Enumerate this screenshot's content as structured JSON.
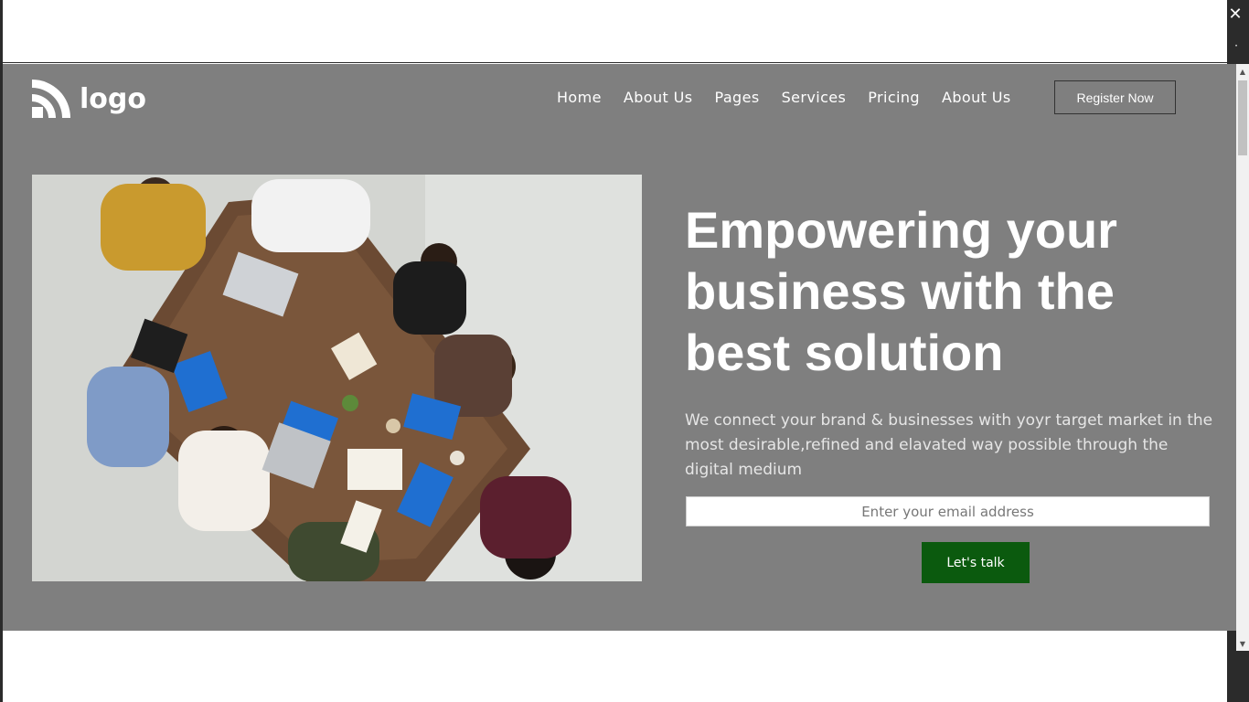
{
  "window": {
    "close_symbol": "✕",
    "menu_symbol": "·"
  },
  "header": {
    "logo_text": "logo",
    "nav": [
      "Home",
      "About Us",
      "Pages",
      "Services",
      "Pricing",
      "About Us"
    ],
    "register_label": "Register Now"
  },
  "hero": {
    "title": "Empowering your business with the best solution",
    "description": "We connect your brand & businesses with yoyr target market in the most desirable,refined and elavated way possible through the digital medium",
    "email_placeholder": "Enter your email address",
    "cta_label": "Let's talk"
  },
  "scrollbar": {
    "up_symbol": "▲",
    "down_symbol": "▼"
  },
  "colors": {
    "page_background": "#7f7f7f",
    "cta_green": "#0b5a0e",
    "text": "#ffffff"
  }
}
